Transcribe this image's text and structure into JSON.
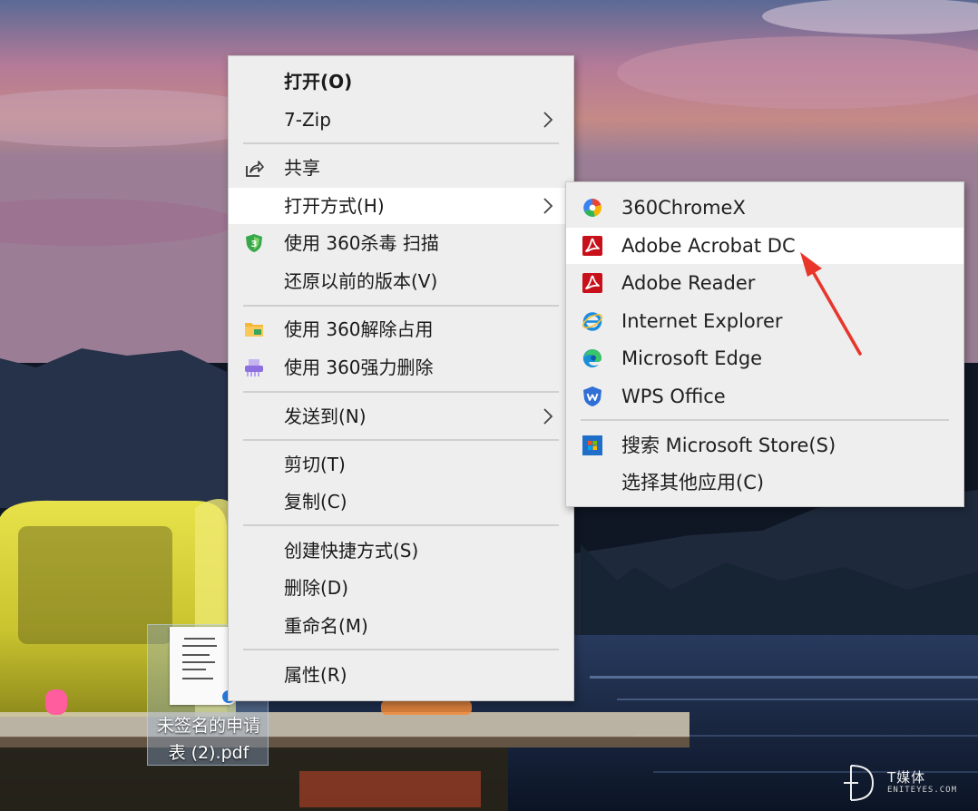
{
  "desktop_file": {
    "name_line1": "未签名的申请",
    "name_line2": "表 (2).pdf"
  },
  "context_menu": {
    "open": "打开(O)",
    "seven_zip": "7-Zip",
    "share": "共享",
    "open_with": "打开方式(H)",
    "scan_360": "使用 360杀毒 扫描",
    "restore_previous": "还原以前的版本(V)",
    "unlock_360": "使用 360解除占用",
    "force_delete_360": "使用 360强力删除",
    "send_to": "发送到(N)",
    "cut": "剪切(T)",
    "copy": "复制(C)",
    "create_shortcut": "创建快捷方式(S)",
    "delete": "删除(D)",
    "rename": "重命名(M)",
    "properties": "属性(R)"
  },
  "open_with_submenu": {
    "items": [
      {
        "label": "360ChromeX",
        "icon": "360chromex-icon"
      },
      {
        "label": "Adobe Acrobat DC",
        "icon": "adobe-acrobat-icon"
      },
      {
        "label": "Adobe Reader",
        "icon": "adobe-reader-icon"
      },
      {
        "label": "Internet Explorer",
        "icon": "internet-explorer-icon"
      },
      {
        "label": "Microsoft Edge",
        "icon": "microsoft-edge-icon"
      },
      {
        "label": "WPS Office",
        "icon": "wps-office-icon"
      }
    ],
    "search_store": "搜索 Microsoft Store(S)",
    "choose_other": "选择其他应用(C)",
    "highlighted_item": "Adobe Acrobat DC"
  },
  "watermark": {
    "title": "T媒体",
    "subtitle": "ENITEYES.COM"
  },
  "colors": {
    "menu_bg": "#eeeeee",
    "highlight": "#ffffff",
    "annotation_arrow": "#e8362b",
    "acrobat_red": "#c8101a",
    "wps_blue": "#2f6fd6"
  }
}
